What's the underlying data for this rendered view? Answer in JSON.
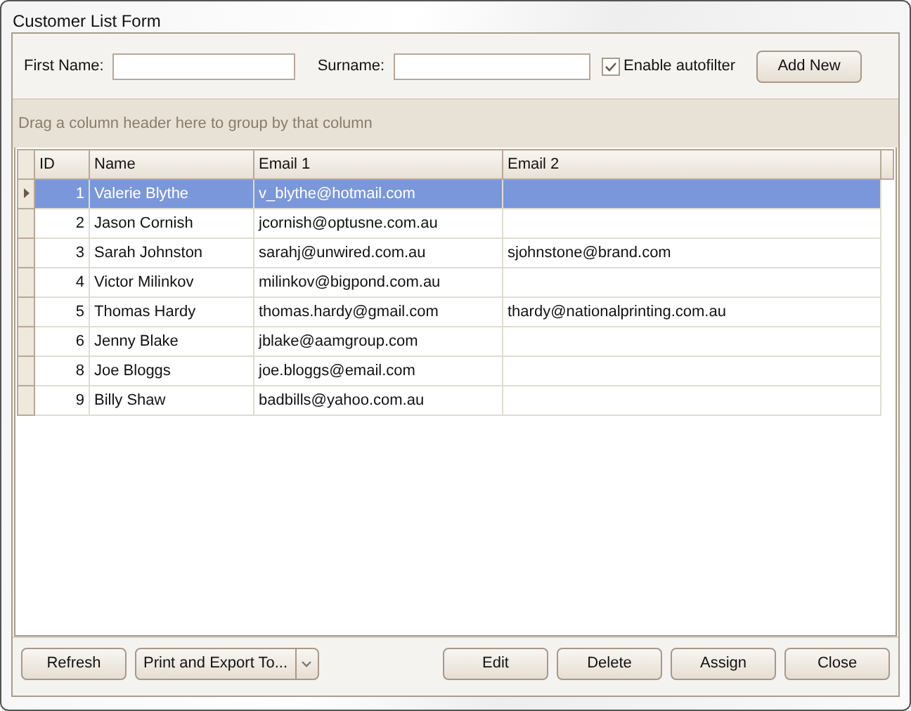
{
  "window": {
    "title": "Customer List Form"
  },
  "filter": {
    "first_name_label": "First Name:",
    "surname_label": "Surname:",
    "autofilter": {
      "label": "Enable autofilter",
      "checked": true
    },
    "add_button": "Add New"
  },
  "group_panel": {
    "hint": "Drag a column header here to group by that column"
  },
  "table": {
    "columns": [
      "ID",
      "Name",
      "Email 1",
      "Email 2"
    ],
    "rows": [
      {
        "selected": true,
        "cells": [
          "1",
          "Valerie Blythe",
          "v_blythe@hotmail.com",
          ""
        ]
      },
      {
        "selected": false,
        "cells": [
          "2",
          "Jason Cornish",
          "jcornish@optusne.com.au",
          ""
        ]
      },
      {
        "selected": false,
        "cells": [
          "3",
          "Sarah Johnston",
          "sarahj@unwired.com.au",
          "sjohnstone@brand.com"
        ]
      },
      {
        "selected": false,
        "cells": [
          "4",
          "Victor Milinkov",
          "milinkov@bigpond.com.au",
          ""
        ]
      },
      {
        "selected": false,
        "cells": [
          "5",
          "Thomas Hardy",
          "thomas.hardy@gmail.com",
          "thardy@nationalprinting.com.au"
        ]
      },
      {
        "selected": false,
        "cells": [
          "6",
          "Jenny Blake",
          "jblake@aamgroup.com",
          ""
        ]
      },
      {
        "selected": false,
        "cells": [
          "8",
          "Joe Bloggs",
          "joe.bloggs@email.com",
          ""
        ]
      },
      {
        "selected": false,
        "cells": [
          "9",
          "Billy Shaw",
          "badbills@yahoo.com.au",
          ""
        ]
      }
    ]
  },
  "buttons": {
    "refresh": "Refresh",
    "print": "Print and Export To...",
    "actions": [
      "Edit",
      "Delete",
      "Assign",
      "Close"
    ]
  }
}
